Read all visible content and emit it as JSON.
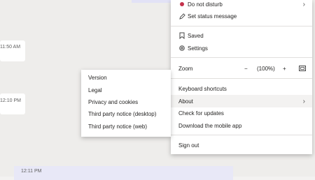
{
  "chat": {
    "timestamps": [
      "11:50 AM",
      "12:10 PM",
      "12:11 PM"
    ]
  },
  "profile_menu": {
    "do_not_disturb": "Do not disturb",
    "set_status": "Set status message",
    "saved": "Saved",
    "settings": "Settings",
    "zoom": {
      "label": "Zoom",
      "minus": "−",
      "value": "(100%)",
      "plus": "+"
    },
    "keyboard_shortcuts": "Keyboard shortcuts",
    "about": "About",
    "check_updates": "Check for updates",
    "download_mobile": "Download the mobile app",
    "sign_out": "Sign out"
  },
  "about_submenu": {
    "items": [
      "Version",
      "Legal",
      "Privacy and cookies",
      "Third party notice (desktop)",
      "Third party notice (web)"
    ]
  },
  "colors": {
    "status_dnd": "#c4314b",
    "highlight": "#f3f2f1"
  }
}
